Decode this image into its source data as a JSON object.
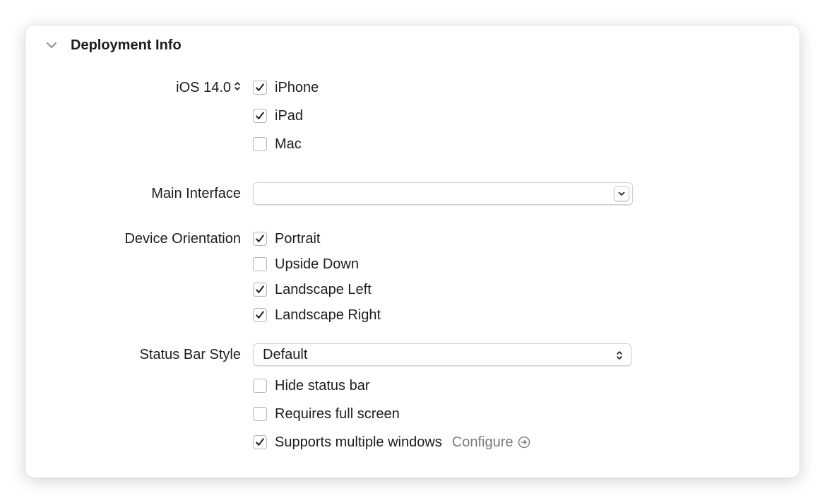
{
  "section": {
    "title": "Deployment Info",
    "icon": "chevron-down-icon"
  },
  "deployment_target": {
    "value": "iOS 14.0",
    "icon": "stepper-arrows-icon"
  },
  "devices": [
    {
      "label": "iPhone",
      "checked": true
    },
    {
      "label": "iPad",
      "checked": true
    },
    {
      "label": "Mac",
      "checked": false
    }
  ],
  "main_interface": {
    "label": "Main Interface",
    "value": ""
  },
  "device_orientation": {
    "label": "Device Orientation",
    "options": [
      {
        "label": "Portrait",
        "checked": true
      },
      {
        "label": "Upside Down",
        "checked": false
      },
      {
        "label": "Landscape Left",
        "checked": true
      },
      {
        "label": "Landscape Right",
        "checked": true
      }
    ]
  },
  "status_bar": {
    "label": "Status Bar Style",
    "value": "Default",
    "options": [
      {
        "label": "Hide status bar",
        "checked": false
      },
      {
        "label": "Requires full screen",
        "checked": false
      },
      {
        "label": "Supports multiple windows",
        "checked": true
      }
    ],
    "configure_label": "Configure"
  },
  "colors": {
    "checkbox_border": "#b5b5b7",
    "check_mark": "#1d1d1f",
    "secondary_text": "#7a7a7e"
  }
}
